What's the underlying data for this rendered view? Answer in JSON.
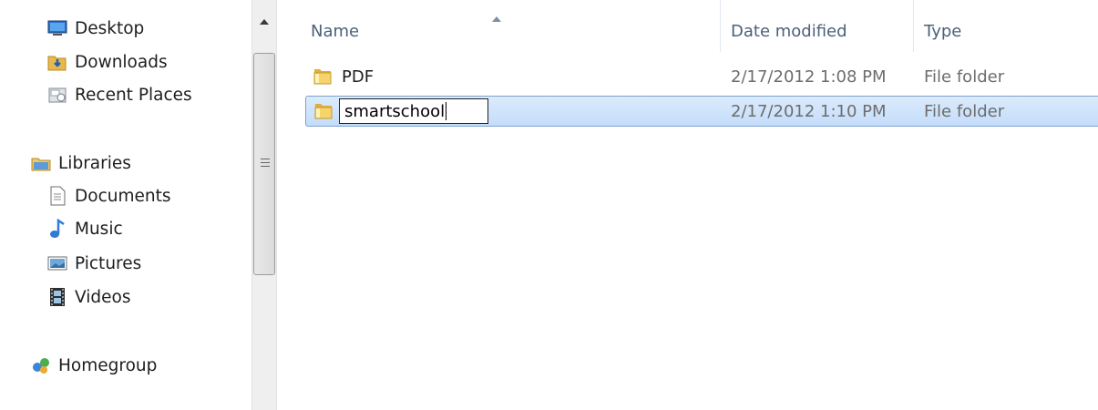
{
  "nav": {
    "items": [
      {
        "label": "Desktop",
        "icon": "desktop-icon"
      },
      {
        "label": "Downloads",
        "icon": "downloads-icon"
      },
      {
        "label": "Recent Places",
        "icon": "recent-places-icon"
      },
      {
        "label": "Libraries",
        "icon": "libraries-icon"
      },
      {
        "label": "Documents",
        "icon": "documents-icon"
      },
      {
        "label": "Music",
        "icon": "music-icon"
      },
      {
        "label": "Pictures",
        "icon": "pictures-icon"
      },
      {
        "label": "Videos",
        "icon": "videos-icon"
      },
      {
        "label": "Homegroup",
        "icon": "homegroup-icon"
      }
    ]
  },
  "columns": {
    "name": "Name",
    "date": "Date modified",
    "type": "Type"
  },
  "files": [
    {
      "name": "PDF",
      "date": "2/17/2012 1:08 PM",
      "type": "File folder",
      "selected": false
    },
    {
      "name": "smartschool",
      "date": "2/17/2012 1:10 PM",
      "type": "File folder",
      "selected": true,
      "renaming": true
    }
  ],
  "colors": {
    "header_text": "#4c607a",
    "selection": "#c4dcfa",
    "selection_border": "#7da2ce"
  }
}
